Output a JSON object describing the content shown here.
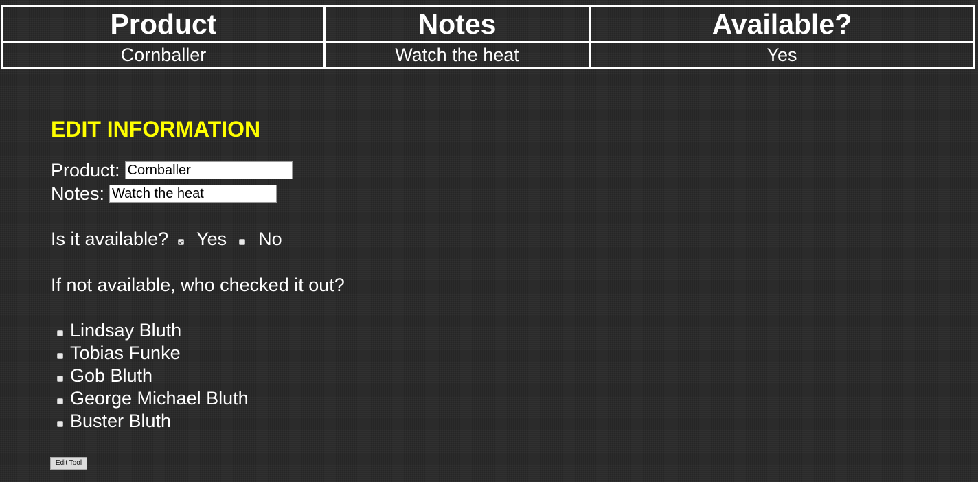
{
  "table": {
    "headers": [
      "Product",
      "Notes",
      "Available?"
    ],
    "rows": [
      [
        "Cornballer",
        "Watch the heat",
        "Yes"
      ]
    ]
  },
  "edit": {
    "heading": "EDIT INFORMATION",
    "product_label": "Product:",
    "product_value": "Cornballer",
    "notes_label": "Notes:",
    "notes_value": "Watch the heat",
    "available_question": "Is it available?",
    "yes_label": "Yes",
    "no_label": "No",
    "yes_checked": true,
    "no_checked": false,
    "checkout_question": "If not available, who checked it out?",
    "people": [
      "Lindsay Bluth",
      "Tobias Funke",
      "Gob Bluth",
      "George Michael Bluth",
      "Buster Bluth"
    ],
    "submit_label": "Edit Tool"
  },
  "colors": {
    "background": "#2b2b2b",
    "heading": "#ffff00",
    "text": "#ffffff"
  }
}
